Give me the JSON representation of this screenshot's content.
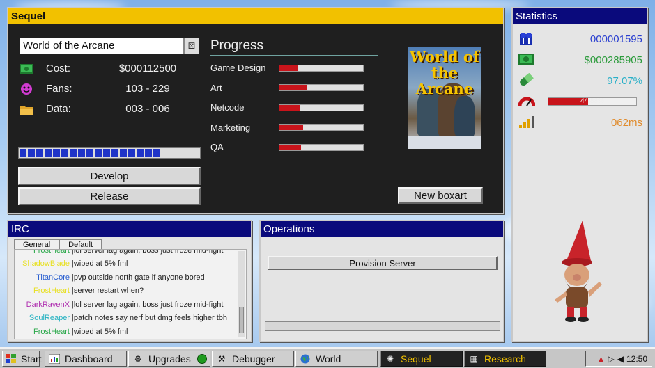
{
  "sequel_window": {
    "title": "Sequel",
    "game_name": "World of the Arcane",
    "stats": [
      {
        "icon": "money-icon",
        "label": "Cost:",
        "value": "$000112500"
      },
      {
        "icon": "smiley-icon",
        "label": "Fans:",
        "value": "103 - 229"
      },
      {
        "icon": "folder-icon",
        "label": "Data:",
        "value": "003 - 006"
      }
    ],
    "dev_progress_fraction": 0.78,
    "develop_label": "Develop",
    "release_label": "Release",
    "progress_title": "Progress",
    "progress_items": [
      {
        "label": "Game Design",
        "fraction": 0.22
      },
      {
        "label": "Art",
        "fraction": 0.33
      },
      {
        "label": "Netcode",
        "fraction": 0.25
      },
      {
        "label": "Marketing",
        "fraction": 0.28
      },
      {
        "label": "QA",
        "fraction": 0.26
      }
    ],
    "boxart_title": "World of the Arcane",
    "new_boxart_label": "New boxart"
  },
  "statistics": {
    "title": "Statistics",
    "players": {
      "icon": "players-icon",
      "value": "000001595",
      "color": "#2a3fd0"
    },
    "money": {
      "icon": "money-icon",
      "value": "$000285905",
      "color": "#2a9a3a"
    },
    "percent": {
      "icon": "pill-icon",
      "value": "97.07%",
      "color": "#2ab0c8"
    },
    "load": {
      "icon": "gauge-icon",
      "value": "44.88%",
      "fraction": 0.4488
    },
    "ping": {
      "icon": "signal-icon",
      "value": "062ms",
      "color": "#e08a2a"
    }
  },
  "irc": {
    "title": "IRC",
    "tabs": [
      "General",
      "Default"
    ],
    "lines": [
      {
        "nick": "FrostHeart",
        "msg": "lol server lag again, boss just froze mid-fight",
        "color": "#2aa84a"
      },
      {
        "nick": "ShadowBlade",
        "msg": "wiped at 5% fml",
        "color": "#e8e020"
      },
      {
        "nick": "TitanCore",
        "msg": "pvp outside north gate if anyone bored",
        "color": "#2a5fd0"
      },
      {
        "nick": "FrostHeart",
        "msg": "server restart when?",
        "color": "#e8e020"
      },
      {
        "nick": "DarkRavenX",
        "msg": "lol server lag again, boss just froze mid-fight",
        "color": "#b030b0"
      },
      {
        "nick": "SoulReaper",
        "msg": "patch notes say nerf but dmg feels higher tbh",
        "color": "#20b0c0"
      },
      {
        "nick": "FrostHeart",
        "msg": "wiped at 5% fml",
        "color": "#2aa84a"
      }
    ]
  },
  "operations": {
    "title": "Operations",
    "provision_label": "Provision Server"
  },
  "taskbar": {
    "start": "Start",
    "items": [
      "Dashboard",
      "Upgrades",
      "Debugger",
      "World",
      "Sequel",
      "Research"
    ],
    "time": "12:50"
  }
}
